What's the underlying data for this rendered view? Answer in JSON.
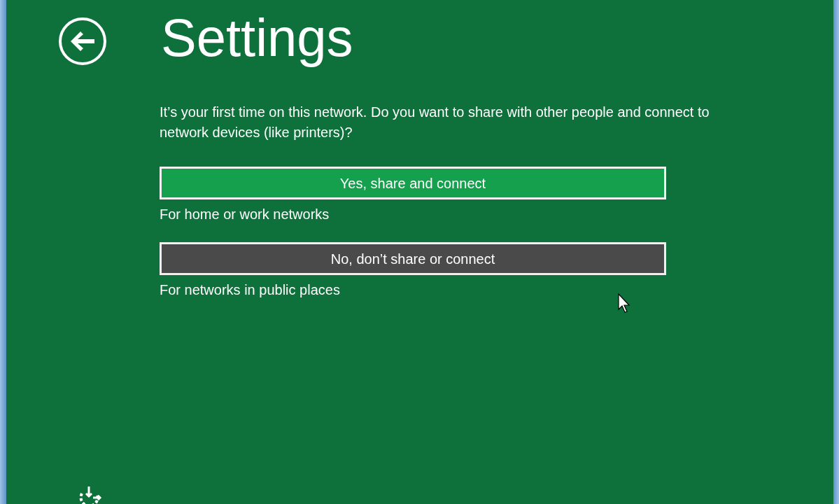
{
  "page": {
    "title": "Settings"
  },
  "message": "It’s your first time on this network. Do you want to share with other people and connect to network devices (like printers)?",
  "options": [
    {
      "label": "Yes, share and connect",
      "description": "For home or work networks",
      "hovered": false
    },
    {
      "label": "No, don’t share or connect",
      "description": "For networks in public places",
      "hovered": true
    }
  ]
}
